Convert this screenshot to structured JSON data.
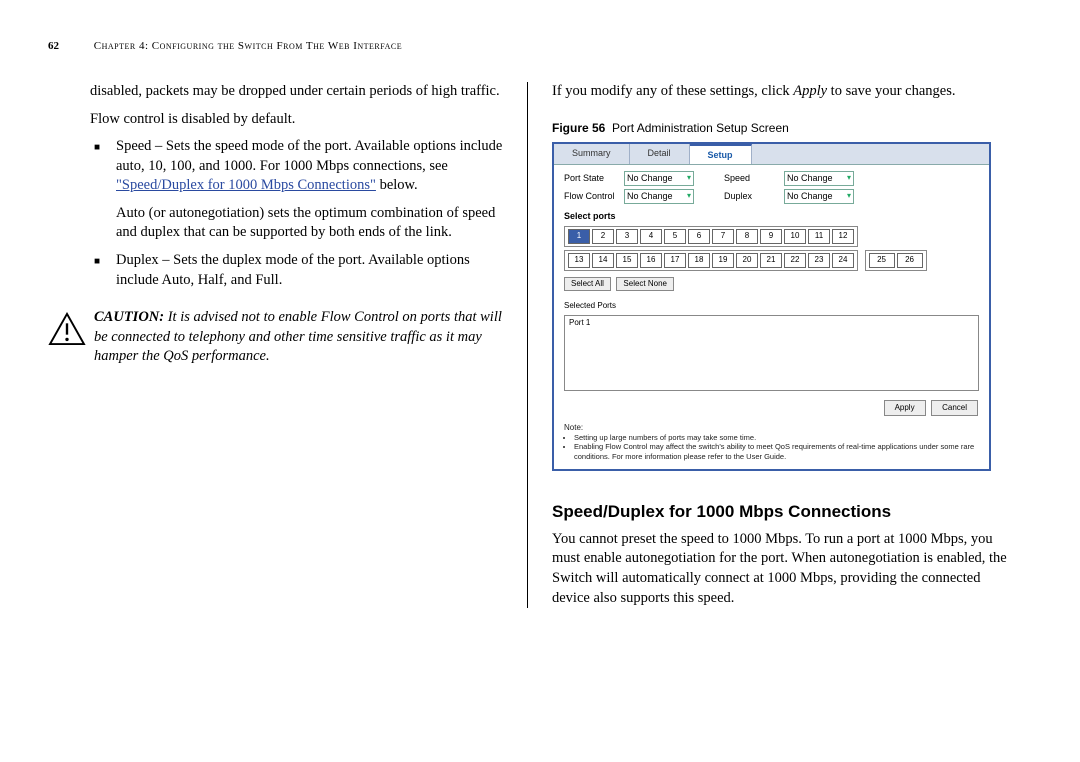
{
  "header": {
    "page_number": "62",
    "chapter": "Chapter 4: Configuring the Switch From The Web Interface"
  },
  "left": {
    "p1": "disabled, packets may be dropped under certain periods of high traffic.",
    "p2": "Flow control is disabled by default.",
    "s1a": "Speed – Sets the speed mode of the port. Available options include auto, 10, 100, and 1000. For 1000 Mbps connections, see ",
    "s1link": "\"Speed/Duplex for 1000 Mbps Connections\"",
    "s1b": " below.",
    "s2": "Auto (or autonegotiation) sets the optimum combination of speed and duplex that can be supported by both ends of the link.",
    "d1": "Duplex – Sets the duplex mode of the port. Available options include Auto, Half, and Full.",
    "caution_label": "CAUTION:",
    "caution_text": " It is advised not to enable Flow Control on ports that will be connected to telephony and other time sensitive traffic as it may hamper the QoS performance."
  },
  "right": {
    "p1a": "If you modify any of these settings, click ",
    "p1em": "Apply",
    "p1b": " to save your changes.",
    "fig_label": "Figure 56",
    "fig_title": "Port Administration Setup Screen",
    "section_heading": "Speed/Duplex for 1000 Mbps Connections",
    "p2": "You cannot preset the speed to 1000 Mbps. To run a port at 1000 Mbps, you must enable autonegotiation for the port. When autonegotiation is enabled, the Switch will automatically connect at 1000 Mbps, providing the connected device also supports this speed."
  },
  "screenshot": {
    "tabs": {
      "summary": "Summary",
      "detail": "Detail",
      "setup": "Setup"
    },
    "form": {
      "port_state_label": "Port State",
      "flow_control_label": "Flow Control",
      "speed_label": "Speed",
      "duplex_label": "Duplex",
      "no_change": "No Change"
    },
    "select_ports_label": "Select ports",
    "row1": [
      "1",
      "2",
      "3",
      "4",
      "5",
      "6",
      "7",
      "8",
      "9",
      "10",
      "11",
      "12"
    ],
    "row2": [
      "13",
      "14",
      "15",
      "16",
      "17",
      "18",
      "19",
      "20",
      "21",
      "22",
      "23",
      "24"
    ],
    "extra": [
      "25",
      "26"
    ],
    "select_all": "Select All",
    "select_none": "Select None",
    "selected_ports_label": "Selected Ports",
    "selected_port_value": "Port 1",
    "apply": "Apply",
    "cancel": "Cancel",
    "note_label": "Note:",
    "note1": "Setting up large numbers of ports may take some time.",
    "note2": "Enabling Flow Control may affect the switch's ability to meet QoS requirements of real-time applications under some rare conditions. For more information please refer to the User Guide."
  }
}
